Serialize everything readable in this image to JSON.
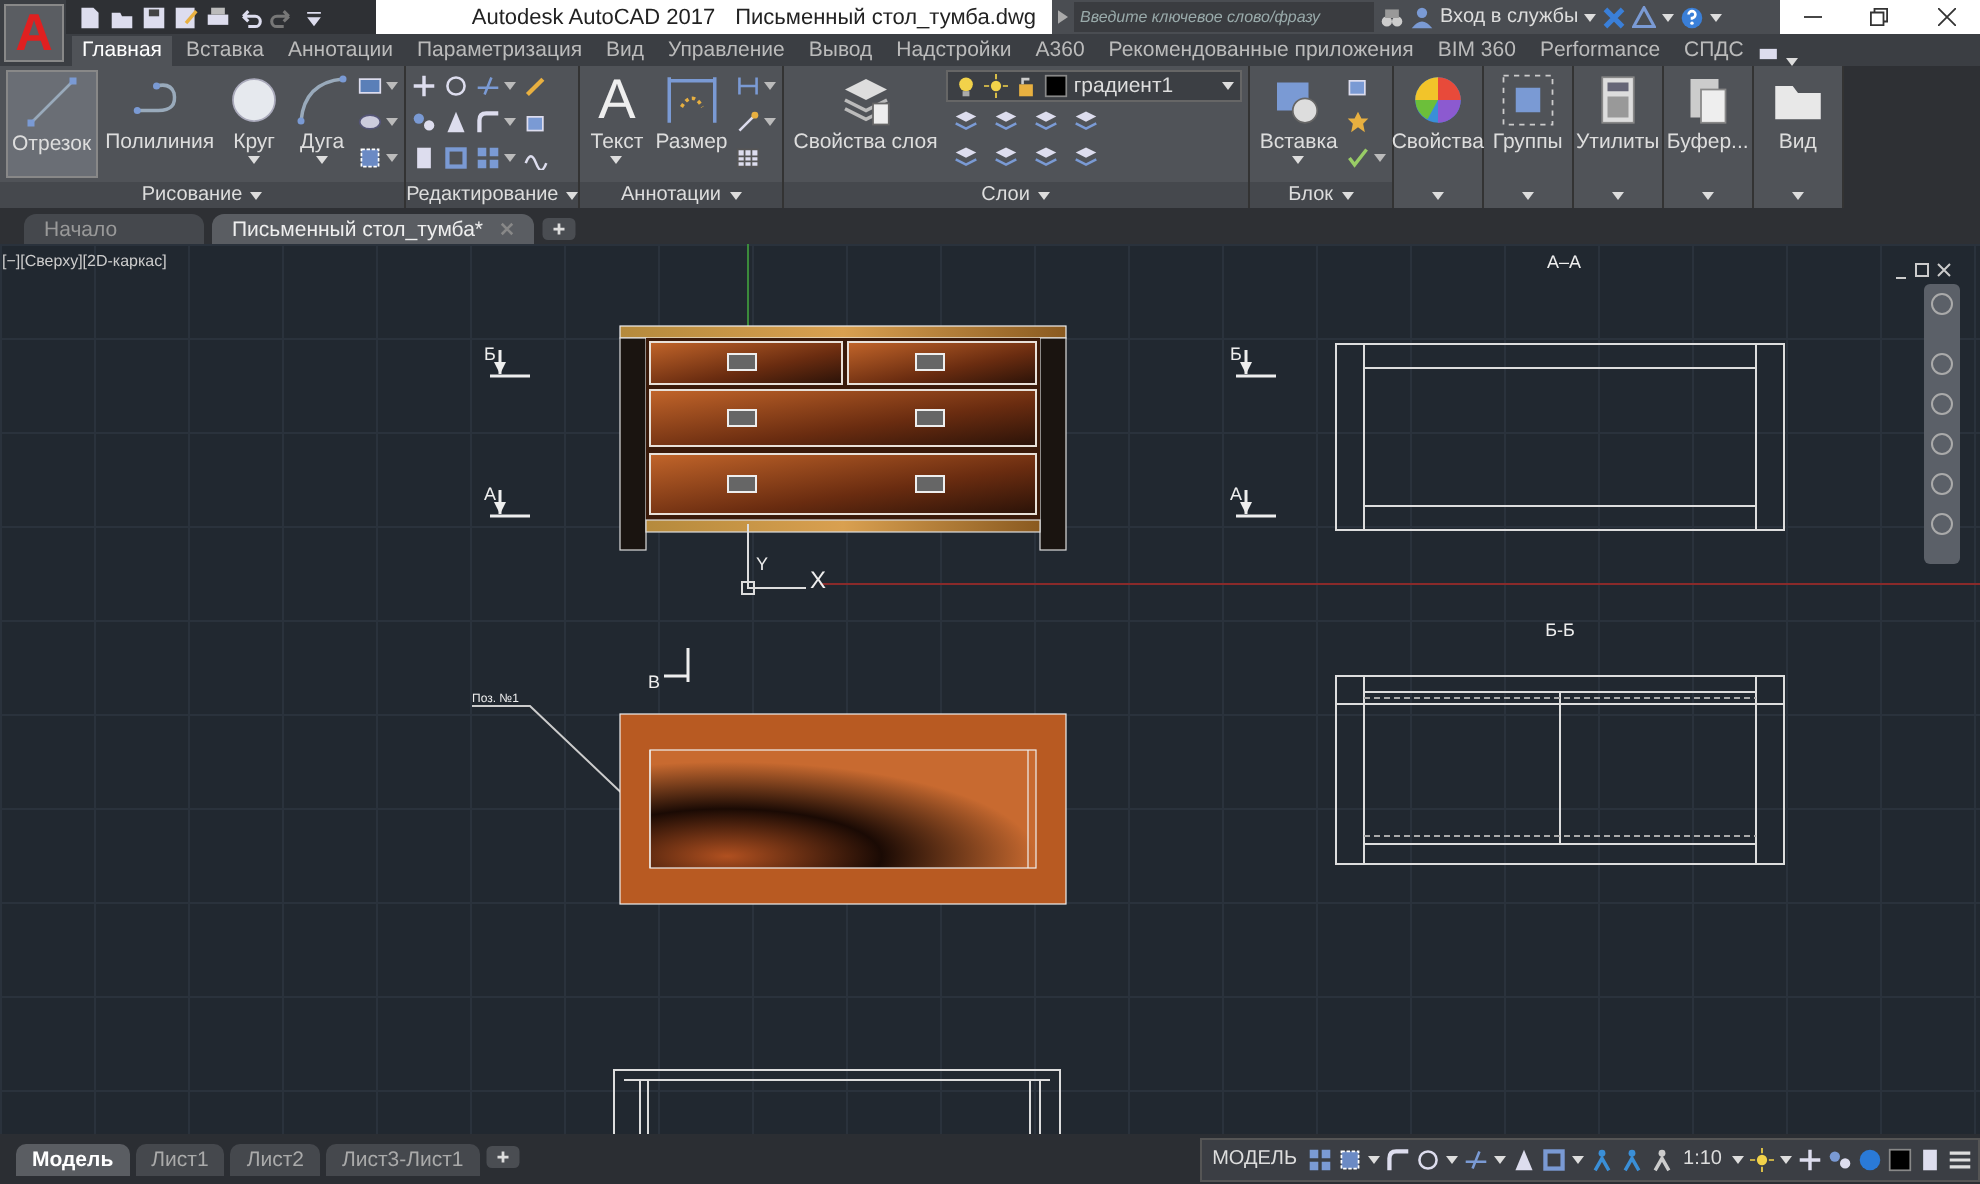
{
  "title_bar": {
    "logo_letter": "A",
    "app_name": "Autodesk AutoCAD 2017",
    "file_name": "Письменный стол_тумба.dwg",
    "search": {
      "placeholder": "Введите ключевое слово/фразу"
    },
    "sign_in": "Вход в службы"
  },
  "ribbon_tabs": [
    {
      "label": "Главная",
      "selected": true
    },
    {
      "label": "Вставка",
      "selected": false
    },
    {
      "label": "Аннотации",
      "selected": false
    },
    {
      "label": "Параметризация",
      "selected": false
    },
    {
      "label": "Вид",
      "selected": false
    },
    {
      "label": "Управление",
      "selected": false
    },
    {
      "label": "Вывод",
      "selected": false
    },
    {
      "label": "Надстройки",
      "selected": false
    },
    {
      "label": "A360",
      "selected": false
    },
    {
      "label": "Рекомендованные приложения",
      "selected": false
    },
    {
      "label": "BIM 360",
      "selected": false
    },
    {
      "label": "Performance",
      "selected": false
    },
    {
      "label": "СПДС",
      "selected": false
    }
  ],
  "ribbon_panels": [
    {
      "kind": "draw",
      "title": "Рисование",
      "tools": [
        {
          "kind": "line",
          "label": "Отрезок",
          "selected": true,
          "dropdown": false
        },
        {
          "kind": "polyline",
          "label": "Полилиния",
          "selected": false,
          "dropdown": false
        },
        {
          "kind": "circle",
          "label": "Круг",
          "selected": false,
          "dropdown": true
        },
        {
          "kind": "arc",
          "label": "Дуга",
          "selected": false,
          "dropdown": true
        }
      ]
    },
    {
      "kind": "modify",
      "title": "Редактирование"
    },
    {
      "kind": "annotate",
      "title": "Аннотации",
      "tools": [
        {
          "kind": "text",
          "glyph": "A",
          "label": "Текст",
          "selected": false,
          "dropdown": true
        },
        {
          "kind": "dimension",
          "label": "Размер",
          "selected": false,
          "dropdown": false
        }
      ]
    },
    {
      "kind": "layers",
      "title": "Слои",
      "layer_dropdown": "градиент1",
      "tools": [
        {
          "kind": "layers",
          "label": "Свойства слоя",
          "selected": false
        }
      ]
    },
    {
      "kind": "block",
      "title": "Блок",
      "tools": [
        {
          "kind": "insert",
          "label": "Вставка",
          "selected": false,
          "dropdown": true
        }
      ]
    }
  ],
  "collapsed_panels": [
    {
      "kind": "color-wheel",
      "label": "Свойства"
    },
    {
      "kind": "groups",
      "label": "Группы"
    },
    {
      "kind": "calculator",
      "label": "Утилиты"
    },
    {
      "kind": "clipboard",
      "label": "Буфер..."
    },
    {
      "kind": "folder",
      "label": "Вид"
    }
  ],
  "document_tabs": [
    {
      "label": "Начало",
      "selected": false
    },
    {
      "label": "Письменный стол_тумба*",
      "selected": true
    }
  ],
  "viewport_label": "[−][Сверху][2D-каркас]",
  "drawing": {
    "view_titles": [
      "А–А",
      "Б-Б"
    ],
    "section_marks": [
      "Б",
      "А",
      "Б",
      "А",
      "В"
    ],
    "callout": "Поз. №1",
    "ucs_labels": [
      "Y",
      "X"
    ]
  },
  "layout_tabs": [
    {
      "label": "Модель",
      "selected": true
    },
    {
      "label": "Лист1",
      "selected": false
    },
    {
      "label": "Лист2",
      "selected": false
    },
    {
      "label": "Лист3-Лист1",
      "selected": false
    }
  ],
  "status_bar": {
    "space": "МОДЕЛЬ",
    "scale": "1:10"
  }
}
